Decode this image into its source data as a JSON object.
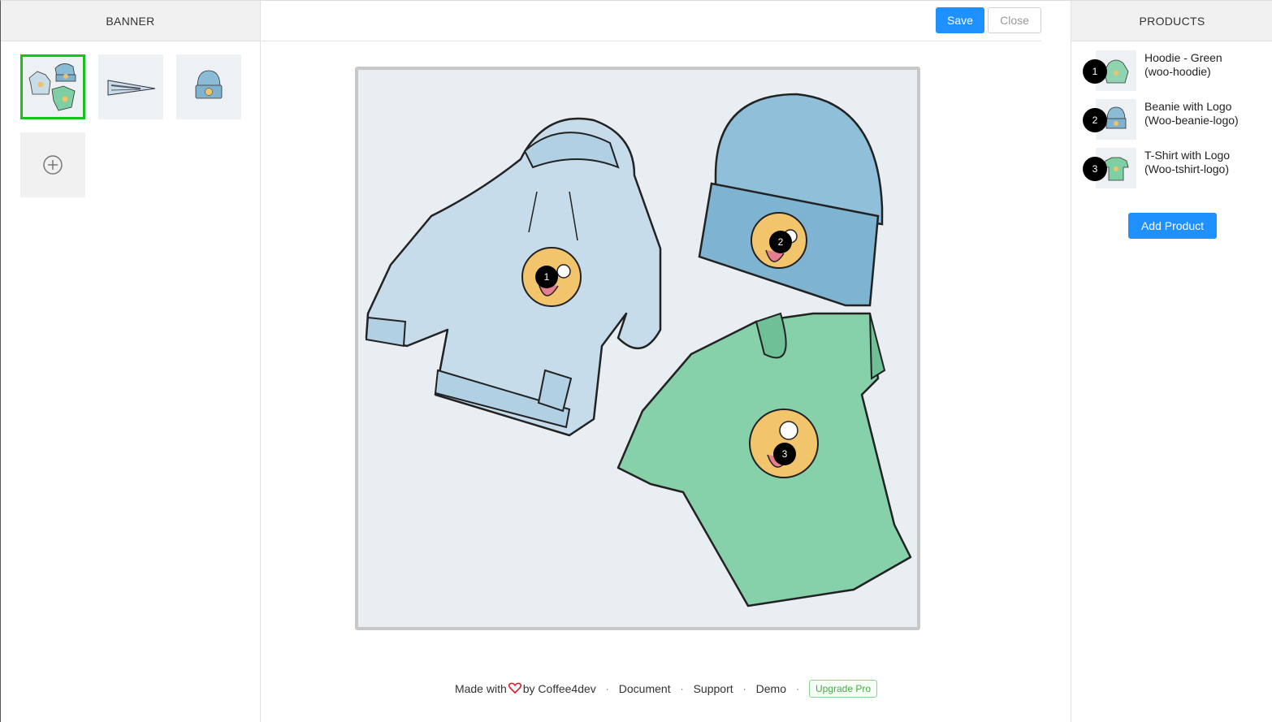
{
  "banner_panel": {
    "title": "BANNER"
  },
  "products_panel": {
    "title": "PRODUCTS",
    "add_button": "Add Product"
  },
  "toolbar": {
    "save_label": "Save",
    "close_label": "Close"
  },
  "thumbnails": [
    {
      "name": "clothing-set",
      "selected": true
    },
    {
      "name": "pennant",
      "selected": false
    },
    {
      "name": "beanie",
      "selected": false
    }
  ],
  "hotspots": [
    {
      "number": "1"
    },
    {
      "number": "2"
    },
    {
      "number": "3"
    }
  ],
  "products": [
    {
      "number": "1",
      "name": "Hoodie - Green",
      "sku": "(woo-hoodie)"
    },
    {
      "number": "2",
      "name": "Beanie with Logo",
      "sku": "(Woo-beanie-logo)"
    },
    {
      "number": "3",
      "name": "T-Shirt with Logo",
      "sku": "(Woo-tshirt-logo)"
    }
  ],
  "footer": {
    "made_with": "Made with",
    "by": "by Coffee4dev",
    "links": [
      "Document",
      "Support",
      "Demo"
    ],
    "upgrade": "Upgrade Pro"
  },
  "colors": {
    "accent": "#1e90ff",
    "selected_border": "#19c11c",
    "heart": "#e0192b",
    "upgrade": "#4aa84a"
  },
  "icons": [
    "plus-circle-icon",
    "heart-icon"
  ]
}
